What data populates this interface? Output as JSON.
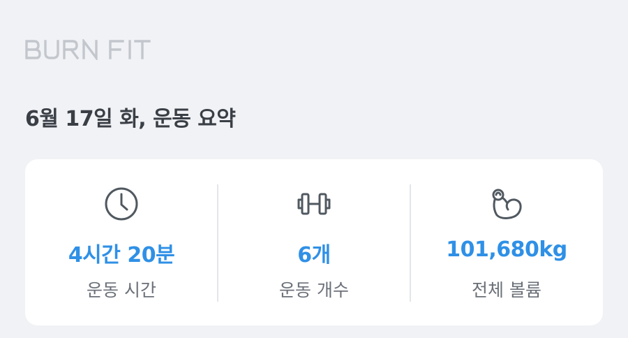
{
  "app": {
    "logo_text": "BURN FIT"
  },
  "summary": {
    "title": "6월 17일 화, 운동 요약"
  },
  "stats": [
    {
      "icon": "clock-icon",
      "value": "4시간 20분",
      "label": "운동 시간"
    },
    {
      "icon": "dumbbell-icon",
      "value": "6개",
      "label": "운동 개수"
    },
    {
      "icon": "flexed-arm-icon",
      "value": "101,680kg",
      "label": "전체 볼륨"
    }
  ],
  "colors": {
    "background": "#f1f2f5",
    "card": "#ffffff",
    "accent": "#2f90e6",
    "title": "#3a3f46",
    "label": "#6b7078",
    "icon": "#505860",
    "logo": "#c3c7cd"
  }
}
